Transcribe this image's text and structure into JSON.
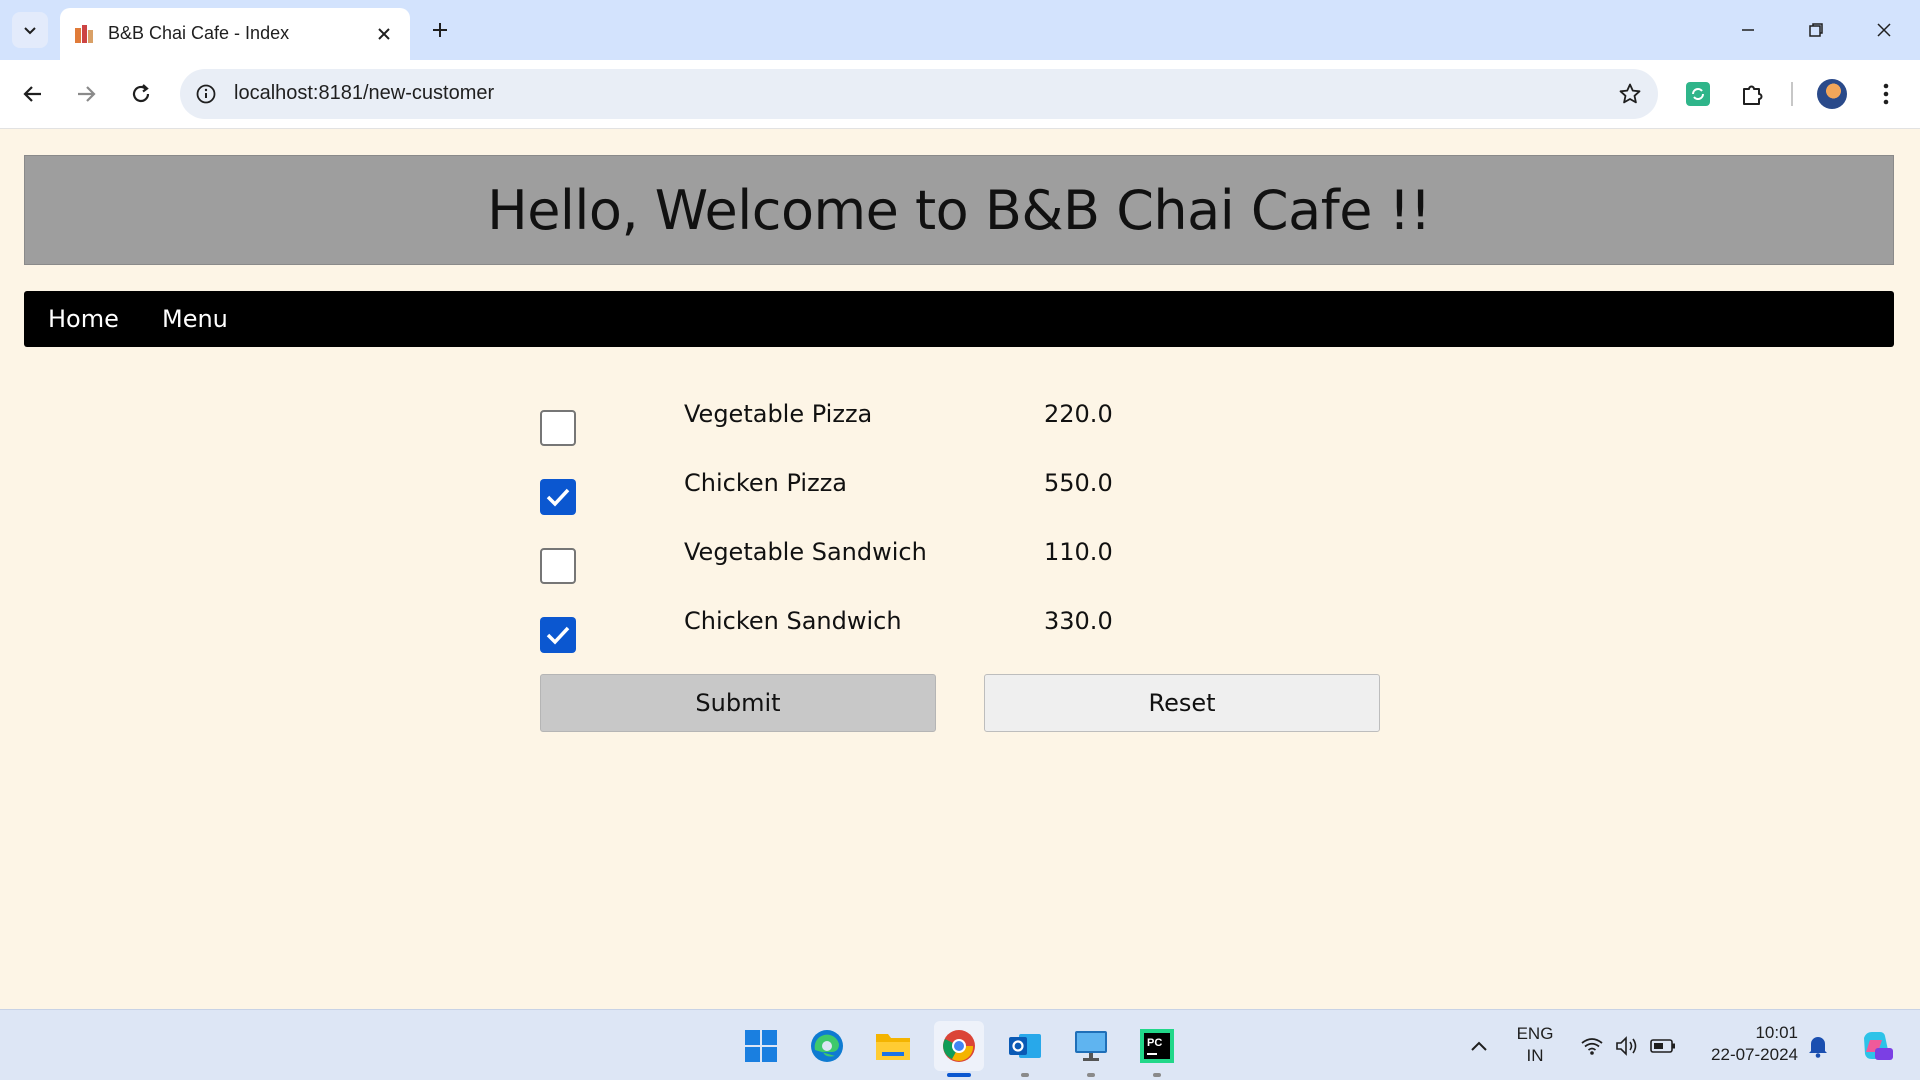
{
  "browser": {
    "tab_title": "B&B Chai Cafe - Index",
    "url": "localhost:8181/new-customer"
  },
  "page": {
    "banner_title": "Hello, Welcome to B&B Chai Cafe !!",
    "nav": {
      "home": "Home",
      "menu": "Menu"
    },
    "items": [
      {
        "name": "Vegetable Pizza",
        "price": "220.0",
        "checked": false
      },
      {
        "name": "Chicken Pizza",
        "price": "550.0",
        "checked": true
      },
      {
        "name": "Vegetable Sandwich",
        "price": "110.0",
        "checked": false
      },
      {
        "name": "Chicken Sandwich",
        "price": "330.0",
        "checked": true
      }
    ],
    "submit_label": "Submit",
    "reset_label": "Reset"
  },
  "taskbar": {
    "apps": [
      "windows-start",
      "edge",
      "file-explorer",
      "chrome",
      "outlook",
      "remote-desktop",
      "pycharm"
    ],
    "language_line1": "ENG",
    "language_line2": "IN",
    "time": "10:01",
    "date": "22-07-2024"
  },
  "colors": {
    "page_bg": "#fdf5e6",
    "banner_bg": "#9e9e9e",
    "navbar_bg": "#000000",
    "checkbox_accent": "#0b57d0"
  }
}
